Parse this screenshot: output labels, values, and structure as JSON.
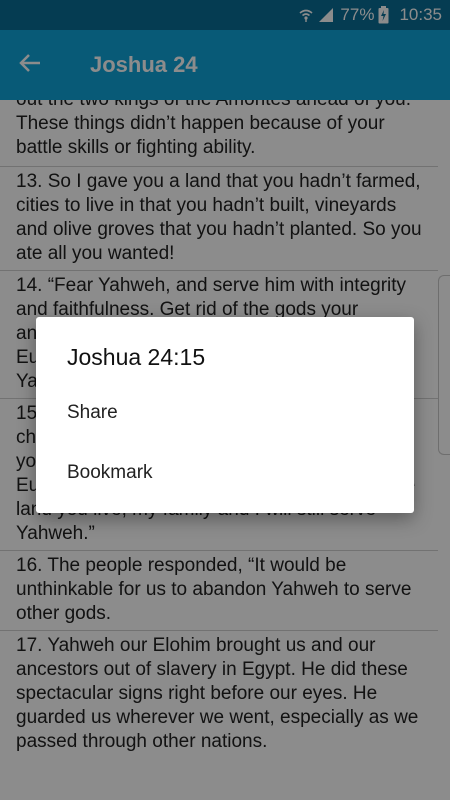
{
  "status_bar": {
    "battery_percent": "77%",
    "time": "10:35",
    "icons": [
      "wifi-calling-icon",
      "signal-icon",
      "battery-charging-icon"
    ]
  },
  "app_bar": {
    "title": "Joshua 24",
    "back_icon": "arrow-left-icon"
  },
  "verses": [
    {
      "text": "out the two kings of the Amorites ahead of you. These things didn’t happen because of your battle skills or fighting ability."
    },
    {
      "text": "13. So I gave you a land that you hadn’t farmed, cities to live in that you hadn’t built, vineyards and olive groves that you hadn’t planted. So you ate all you wanted!"
    },
    {
      "text": "14. “Fear Yahweh, and serve him with integrity and faithfulness. Get rid of the gods your ancestors served on the other side of the Euphrates River and in Egypt, and serve Yahweh."
    },
    {
      "text": "15. But if you don’t want to serve Yahweh, then choose today whom you will serve—the gods your ancestors served on the other side of the Euphrates or the gods of the Amorites in whose land you live, my family and I will still serve Yahweh.”"
    },
    {
      "text": "16. The people responded, “It would be unthinkable for us to abandon Yahweh to serve other gods."
    },
    {
      "text": "17. Yahweh our Elohim brought us and our ancestors out of slavery in Egypt. He did these spectacular signs right before our eyes. He guarded us wherever we went, especially as we passed through other nations."
    }
  ],
  "dialog": {
    "title": "Joshua 24:15",
    "options": [
      {
        "label": "Share"
      },
      {
        "label": "Bookmark"
      }
    ]
  },
  "colors": {
    "status_bar": "#0a6d96",
    "app_bar": "#10a5d9",
    "scrim": "rgba(0,0,0,0.45)"
  }
}
